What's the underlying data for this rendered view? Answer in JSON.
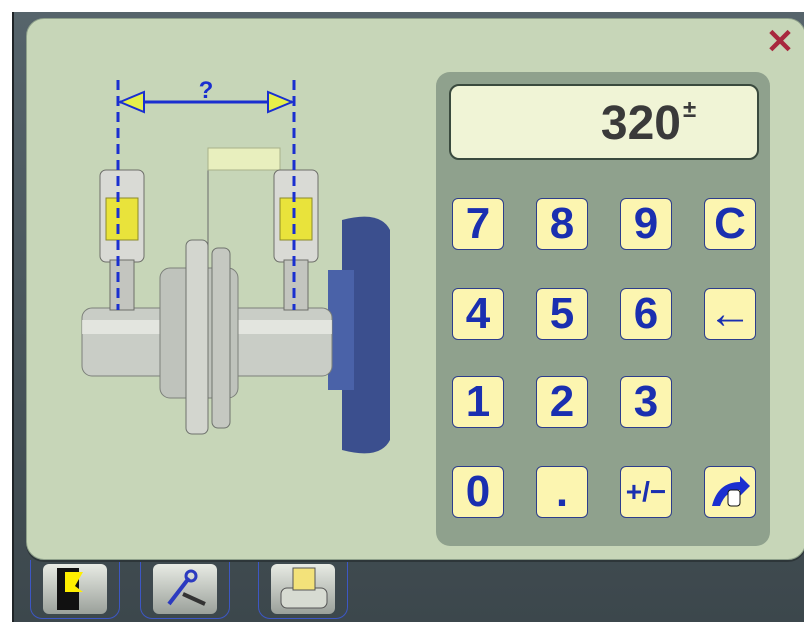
{
  "display": {
    "value": "320",
    "sign": "±"
  },
  "illustration": {
    "distance_label": "?"
  },
  "keypad": {
    "keys": [
      "7",
      "8",
      "9",
      "C",
      "4",
      "5",
      "6",
      "←",
      "1",
      "2",
      "3",
      "0",
      ".",
      "+/−"
    ]
  },
  "icons": {
    "close": "close-icon",
    "backspace": "backspace-arrow-icon",
    "enter": "hand-pointer-arrow-icon",
    "taskbar": [
      "exit-door-icon",
      "tools-wrench-icon",
      "sensor-device-icon"
    ]
  },
  "colors": {
    "key_text": "#1a2fb0",
    "key_bg": "#fcf5b0",
    "dialog_bg": "#c7d6b8",
    "close": "#a8283e"
  }
}
